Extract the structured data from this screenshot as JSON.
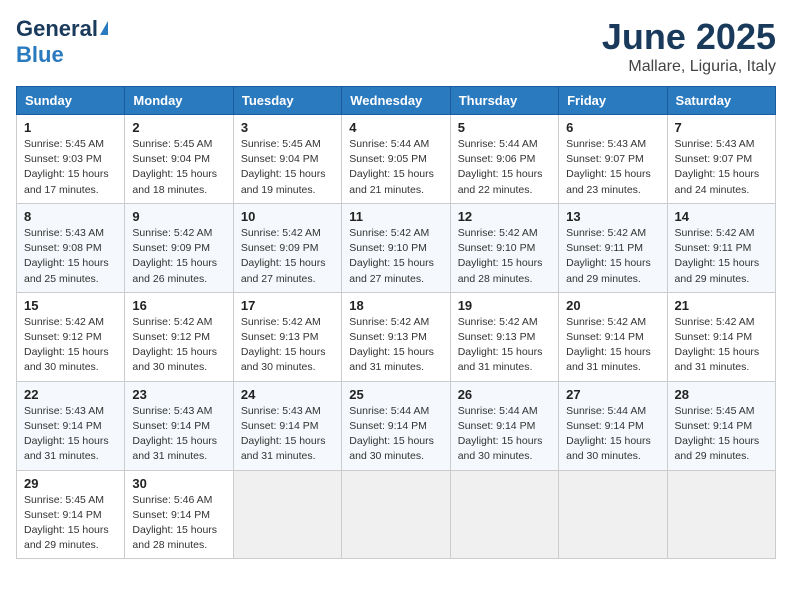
{
  "header": {
    "logo_general": "General",
    "logo_blue": "Blue",
    "month": "June 2025",
    "location": "Mallare, Liguria, Italy"
  },
  "weekdays": [
    "Sunday",
    "Monday",
    "Tuesday",
    "Wednesday",
    "Thursday",
    "Friday",
    "Saturday"
  ],
  "weeks": [
    [
      {
        "day": 1,
        "sunrise": "5:45 AM",
        "sunset": "9:03 PM",
        "daylight": "15 hours and 17 minutes."
      },
      {
        "day": 2,
        "sunrise": "5:45 AM",
        "sunset": "9:04 PM",
        "daylight": "15 hours and 18 minutes."
      },
      {
        "day": 3,
        "sunrise": "5:45 AM",
        "sunset": "9:04 PM",
        "daylight": "15 hours and 19 minutes."
      },
      {
        "day": 4,
        "sunrise": "5:44 AM",
        "sunset": "9:05 PM",
        "daylight": "15 hours and 21 minutes."
      },
      {
        "day": 5,
        "sunrise": "5:44 AM",
        "sunset": "9:06 PM",
        "daylight": "15 hours and 22 minutes."
      },
      {
        "day": 6,
        "sunrise": "5:43 AM",
        "sunset": "9:07 PM",
        "daylight": "15 hours and 23 minutes."
      },
      {
        "day": 7,
        "sunrise": "5:43 AM",
        "sunset": "9:07 PM",
        "daylight": "15 hours and 24 minutes."
      }
    ],
    [
      {
        "day": 8,
        "sunrise": "5:43 AM",
        "sunset": "9:08 PM",
        "daylight": "15 hours and 25 minutes."
      },
      {
        "day": 9,
        "sunrise": "5:42 AM",
        "sunset": "9:09 PM",
        "daylight": "15 hours and 26 minutes."
      },
      {
        "day": 10,
        "sunrise": "5:42 AM",
        "sunset": "9:09 PM",
        "daylight": "15 hours and 27 minutes."
      },
      {
        "day": 11,
        "sunrise": "5:42 AM",
        "sunset": "9:10 PM",
        "daylight": "15 hours and 27 minutes."
      },
      {
        "day": 12,
        "sunrise": "5:42 AM",
        "sunset": "9:10 PM",
        "daylight": "15 hours and 28 minutes."
      },
      {
        "day": 13,
        "sunrise": "5:42 AM",
        "sunset": "9:11 PM",
        "daylight": "15 hours and 29 minutes."
      },
      {
        "day": 14,
        "sunrise": "5:42 AM",
        "sunset": "9:11 PM",
        "daylight": "15 hours and 29 minutes."
      }
    ],
    [
      {
        "day": 15,
        "sunrise": "5:42 AM",
        "sunset": "9:12 PM",
        "daylight": "15 hours and 30 minutes."
      },
      {
        "day": 16,
        "sunrise": "5:42 AM",
        "sunset": "9:12 PM",
        "daylight": "15 hours and 30 minutes."
      },
      {
        "day": 17,
        "sunrise": "5:42 AM",
        "sunset": "9:13 PM",
        "daylight": "15 hours and 30 minutes."
      },
      {
        "day": 18,
        "sunrise": "5:42 AM",
        "sunset": "9:13 PM",
        "daylight": "15 hours and 31 minutes."
      },
      {
        "day": 19,
        "sunrise": "5:42 AM",
        "sunset": "9:13 PM",
        "daylight": "15 hours and 31 minutes."
      },
      {
        "day": 20,
        "sunrise": "5:42 AM",
        "sunset": "9:14 PM",
        "daylight": "15 hours and 31 minutes."
      },
      {
        "day": 21,
        "sunrise": "5:42 AM",
        "sunset": "9:14 PM",
        "daylight": "15 hours and 31 minutes."
      }
    ],
    [
      {
        "day": 22,
        "sunrise": "5:43 AM",
        "sunset": "9:14 PM",
        "daylight": "15 hours and 31 minutes."
      },
      {
        "day": 23,
        "sunrise": "5:43 AM",
        "sunset": "9:14 PM",
        "daylight": "15 hours and 31 minutes."
      },
      {
        "day": 24,
        "sunrise": "5:43 AM",
        "sunset": "9:14 PM",
        "daylight": "15 hours and 31 minutes."
      },
      {
        "day": 25,
        "sunrise": "5:44 AM",
        "sunset": "9:14 PM",
        "daylight": "15 hours and 30 minutes."
      },
      {
        "day": 26,
        "sunrise": "5:44 AM",
        "sunset": "9:14 PM",
        "daylight": "15 hours and 30 minutes."
      },
      {
        "day": 27,
        "sunrise": "5:44 AM",
        "sunset": "9:14 PM",
        "daylight": "15 hours and 30 minutes."
      },
      {
        "day": 28,
        "sunrise": "5:45 AM",
        "sunset": "9:14 PM",
        "daylight": "15 hours and 29 minutes."
      }
    ],
    [
      {
        "day": 29,
        "sunrise": "5:45 AM",
        "sunset": "9:14 PM",
        "daylight": "15 hours and 29 minutes."
      },
      {
        "day": 30,
        "sunrise": "5:46 AM",
        "sunset": "9:14 PM",
        "daylight": "15 hours and 28 minutes."
      },
      null,
      null,
      null,
      null,
      null
    ]
  ]
}
